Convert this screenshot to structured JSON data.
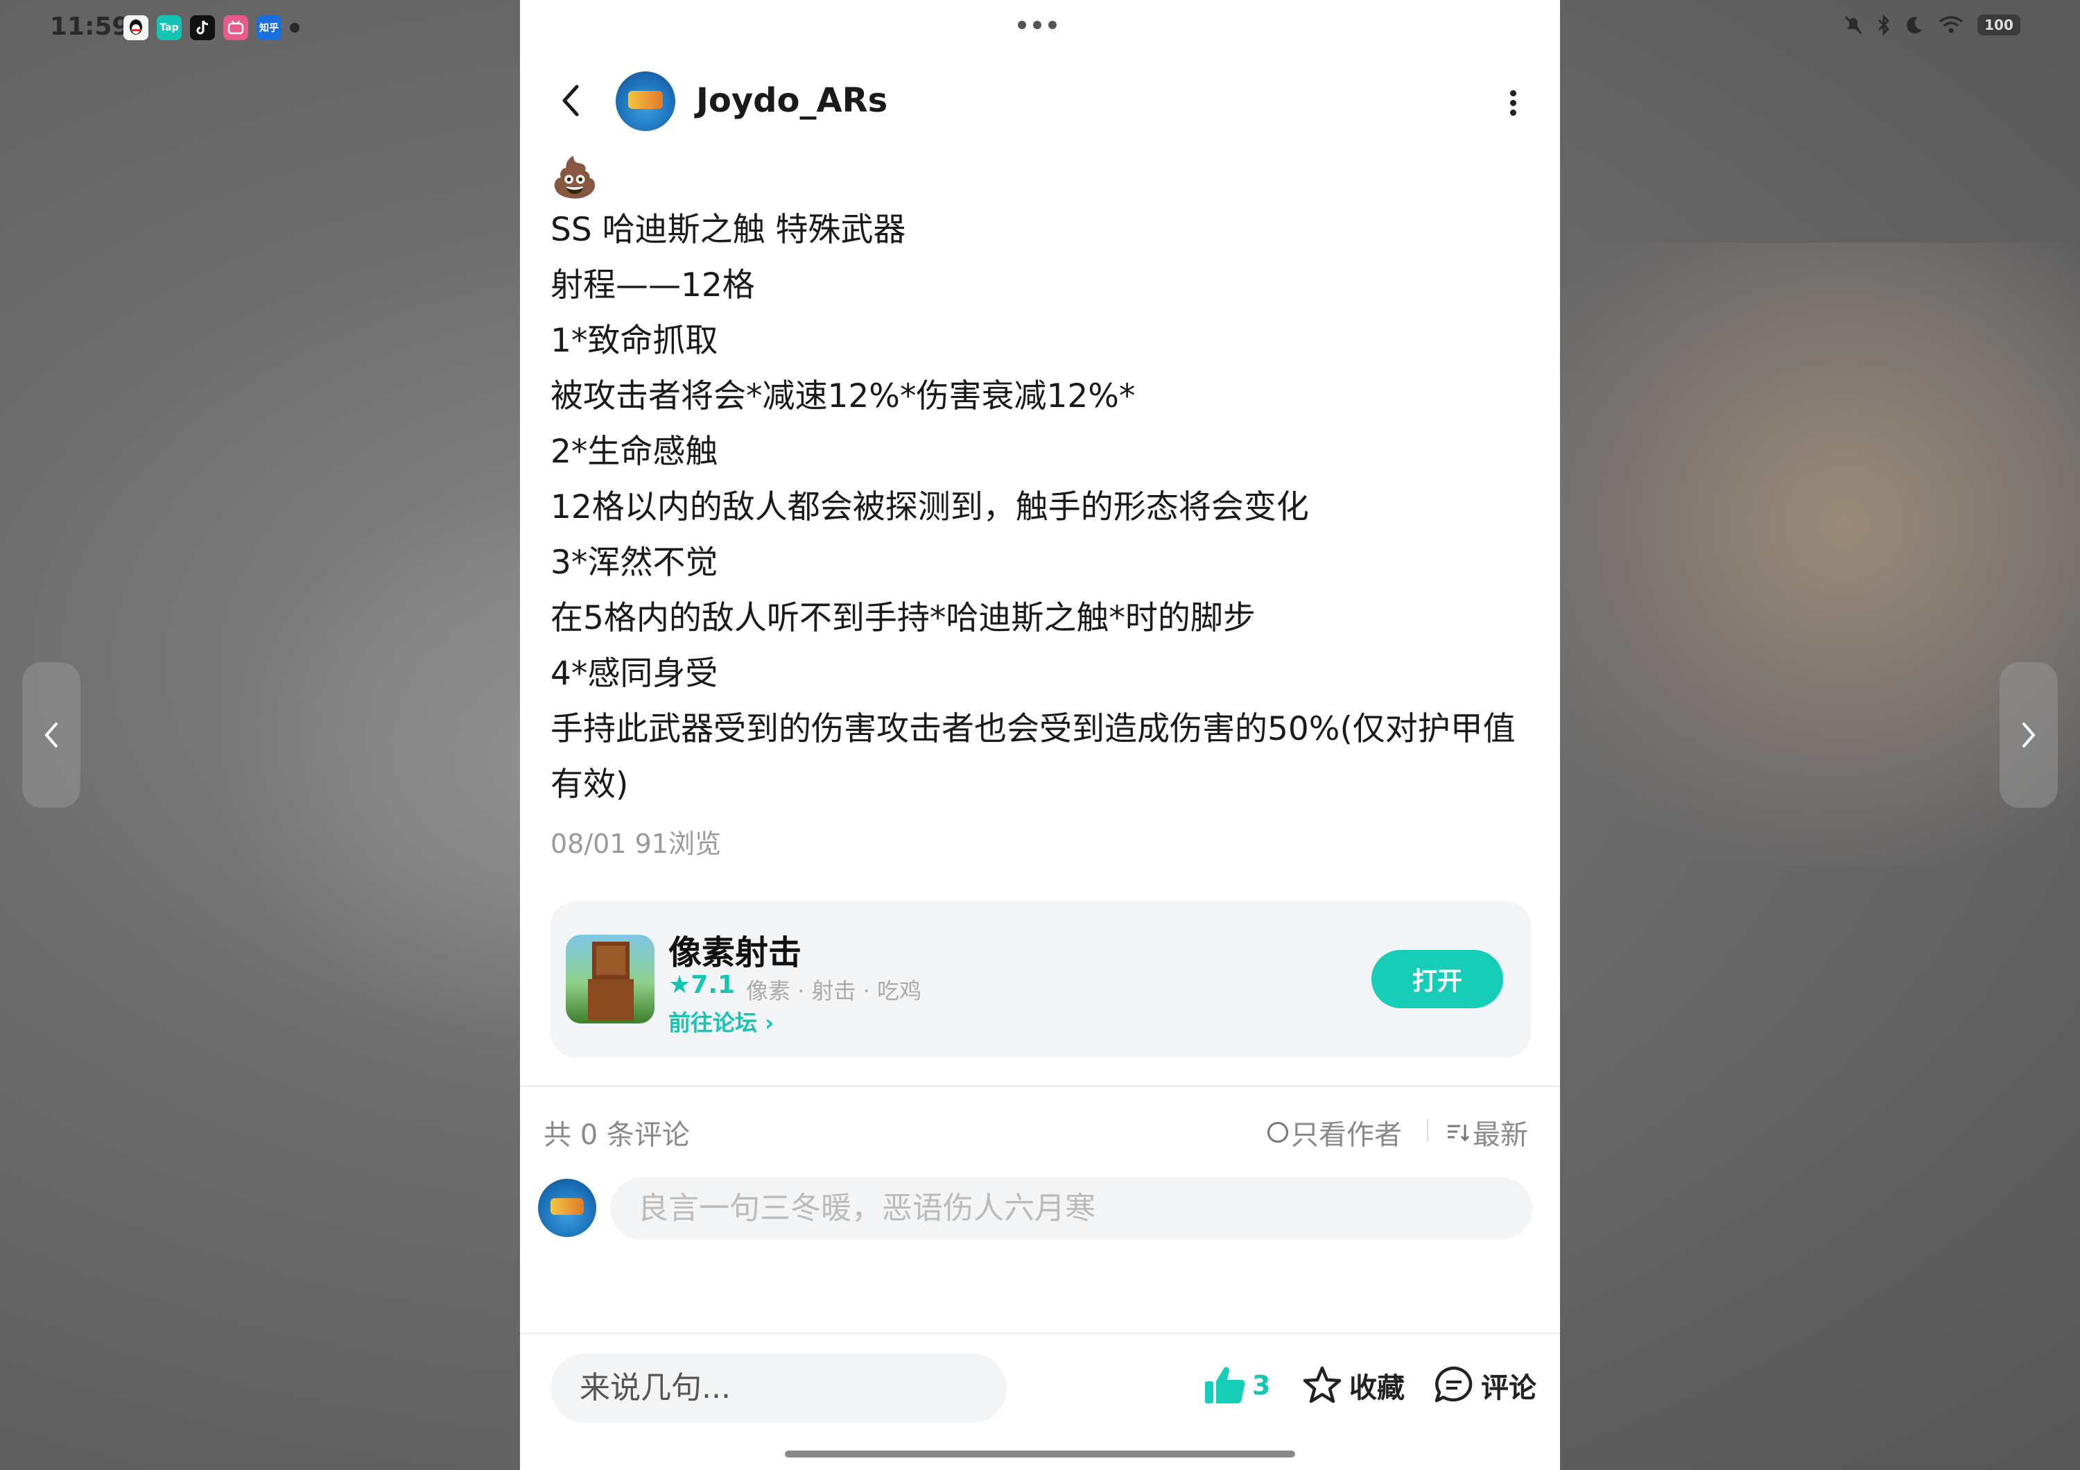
{
  "status_bar": {
    "time": "11:59",
    "apps": [
      {
        "icon": "qq-icon",
        "label": "",
        "color": "#f5f5f5"
      },
      {
        "icon": "taptap-icon",
        "label": "Tap",
        "color": "#15c5b3"
      },
      {
        "icon": "tiktok-icon",
        "label": "",
        "color": "#111111"
      },
      {
        "icon": "bilibili-icon",
        "label": "",
        "color": "#e85a8a"
      },
      {
        "icon": "zhihu-icon",
        "label": "知乎",
        "color": "#1a6fe0"
      }
    ],
    "battery": "100"
  },
  "header": {
    "username": "Joydo_ARs"
  },
  "post": {
    "emoji": "💩",
    "lines": [
      "SS 哈迪斯之触 特殊武器",
      "射程——12格",
      "1*致命抓取",
      "被攻击者将会*减速12%*伤害衰减12%*",
      "2*生命感触",
      "12格以内的敌人都会被探测到，触手的形态将会变化",
      "3*浑然不觉",
      "在5格内的敌人听不到手持*哈迪斯之触*时的脚步",
      "4*感同身受",
      "手持此武器受到的伤害攻击者也会受到造成伤害的50%(仅对护甲值有效)"
    ],
    "date": "08/01",
    "views": "91浏览"
  },
  "game_card": {
    "name": "像素射击",
    "rating": "★7.1",
    "tags": "像素 · 射击 · 吃鸡",
    "forum_link": "前往论坛 ›",
    "open_label": "打开"
  },
  "comments": {
    "count_label": "共 0 条评论",
    "author_only_label": "只看作者",
    "sort_label": "最新",
    "input_placeholder": "良言一句三冬暖，恶语伤人六月寒"
  },
  "bottom_bar": {
    "say_placeholder": "来说几句...",
    "like_count": "3",
    "favorite_label": "收藏",
    "comment_label": "评论"
  },
  "colors": {
    "accent": "#16cdb8",
    "panel_bg": "#ffffff",
    "card_bg": "#f2f4f5"
  }
}
